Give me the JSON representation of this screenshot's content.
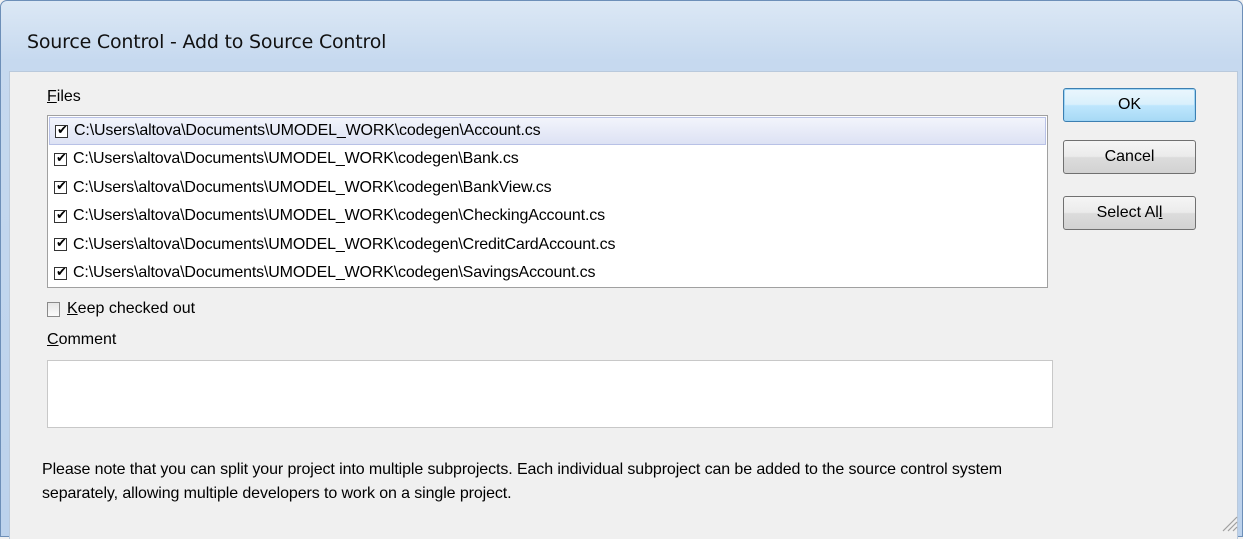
{
  "window": {
    "title": "Source Control - Add to Source Control"
  },
  "files": {
    "label_mnemonic": "F",
    "label_rest": "iles",
    "items": [
      {
        "path": "C:\\Users\\altova\\Documents\\UMODEL_WORK\\codegen\\Account.cs",
        "checked": true,
        "selected": true
      },
      {
        "path": "C:\\Users\\altova\\Documents\\UMODEL_WORK\\codegen\\Bank.cs",
        "checked": true,
        "selected": false
      },
      {
        "path": "C:\\Users\\altova\\Documents\\UMODEL_WORK\\codegen\\BankView.cs",
        "checked": true,
        "selected": false
      },
      {
        "path": "C:\\Users\\altova\\Documents\\UMODEL_WORK\\codegen\\CheckingAccount.cs",
        "checked": true,
        "selected": false
      },
      {
        "path": "C:\\Users\\altova\\Documents\\UMODEL_WORK\\codegen\\CreditCardAccount.cs",
        "checked": true,
        "selected": false
      },
      {
        "path": "C:\\Users\\altova\\Documents\\UMODEL_WORK\\codegen\\SavingsAccount.cs",
        "checked": true,
        "selected": false
      }
    ]
  },
  "keep_checked_out": {
    "label_mnemonic": "K",
    "label_rest": "eep checked out",
    "checked": false
  },
  "comment": {
    "label_mnemonic": "C",
    "label_rest": "omment",
    "value": ""
  },
  "note": "Please note that you can split your project into multiple subprojects. Each individual subproject can be added to the source control system separately, allowing multiple developers to work on a single project.",
  "buttons": {
    "ok": "OK",
    "cancel": "Cancel",
    "select_all_before": "Select A",
    "select_all_mnemonic": "l",
    "select_all_after": "l"
  },
  "icons": {
    "checkbox_checked": "check-mark",
    "resize_grip": "resize-grip-icon"
  }
}
